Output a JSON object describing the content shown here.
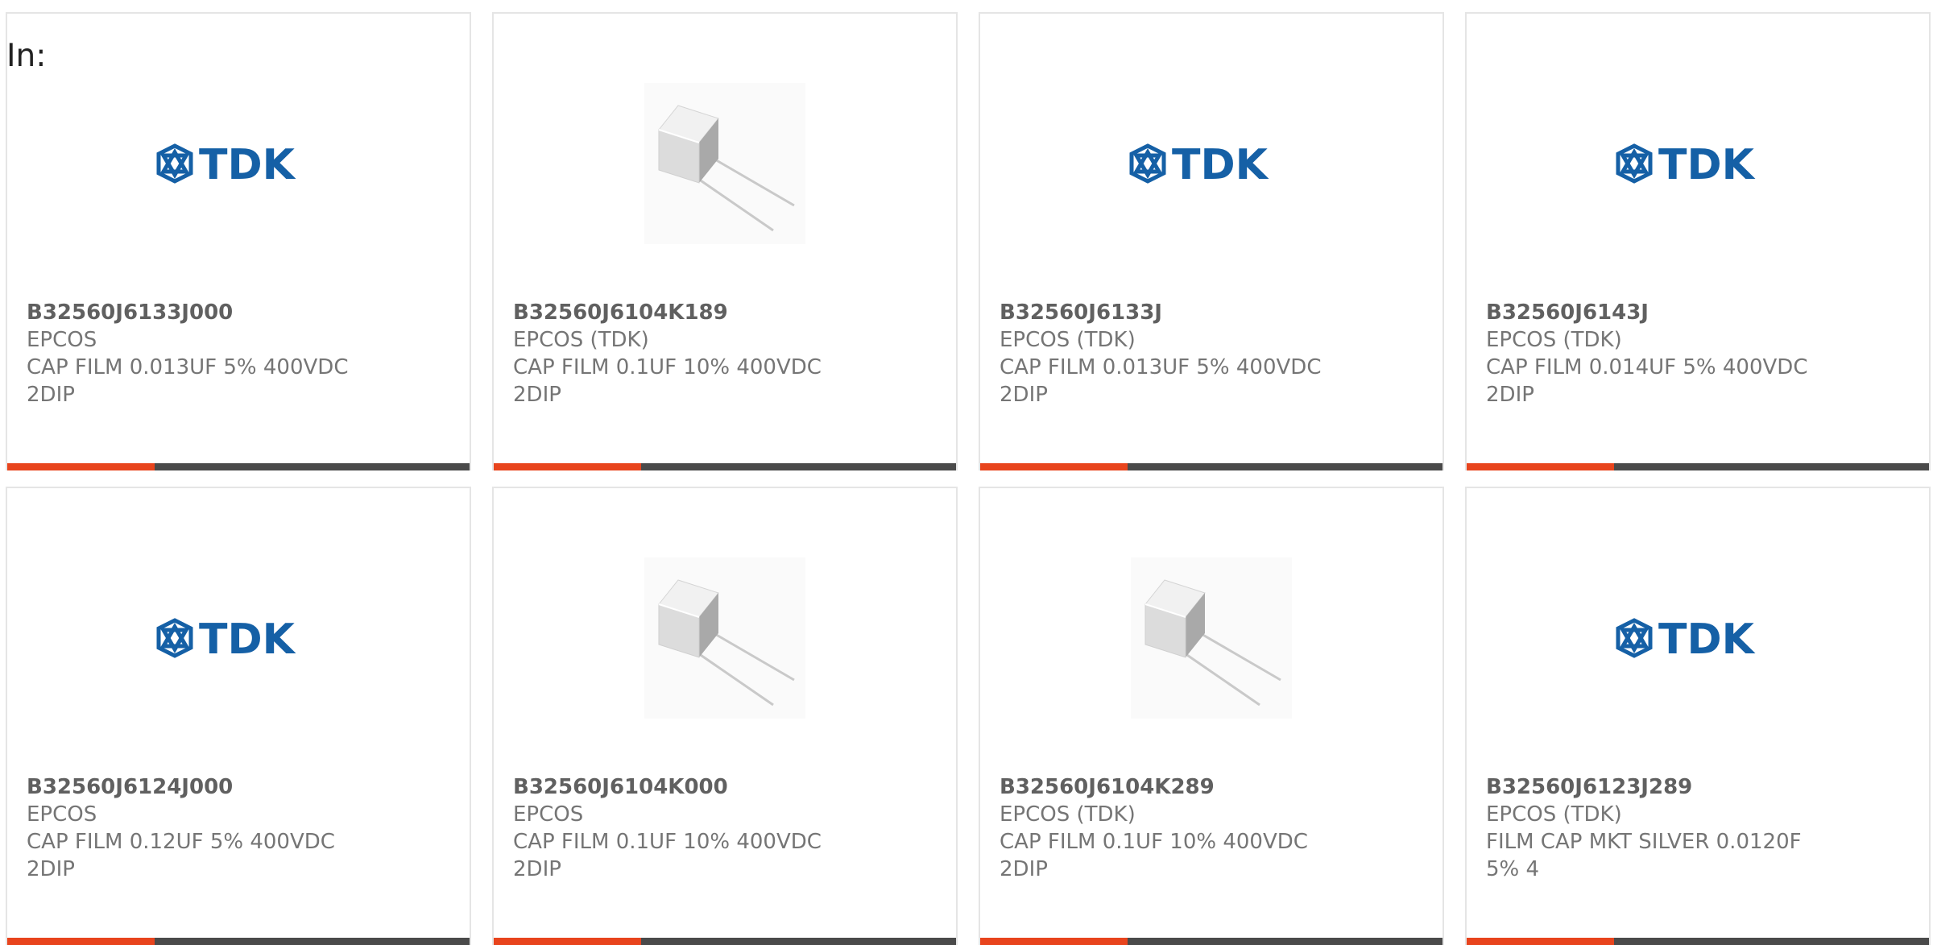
{
  "header": {
    "in_label": "In:"
  },
  "colors": {
    "accent": "#e8441d",
    "bar_dark": "#4a4a4a",
    "tdk_blue": "#1560a6"
  },
  "brand": {
    "logo_text": "TDK"
  },
  "products": [
    {
      "part_number": "B32560J6133J000",
      "manufacturer": "EPCOS",
      "description": "CAP FILM 0.013UF 5% 400VDC",
      "package": "2DIP",
      "image": "tdk-logo"
    },
    {
      "part_number": "B32560J6104K189",
      "manufacturer": "EPCOS (TDK)",
      "description": "CAP FILM 0.1UF 10% 400VDC",
      "package": "2DIP",
      "image": "capacitor-photo"
    },
    {
      "part_number": "B32560J6133J",
      "manufacturer": "EPCOS (TDK)",
      "description": "CAP FILM 0.013UF 5% 400VDC",
      "package": "2DIP",
      "image": "tdk-logo"
    },
    {
      "part_number": "B32560J6143J",
      "manufacturer": "EPCOS (TDK)",
      "description": "CAP FILM 0.014UF 5% 400VDC",
      "package": "2DIP",
      "image": "tdk-logo"
    },
    {
      "part_number": "B32560J6124J000",
      "manufacturer": "EPCOS",
      "description": "CAP FILM 0.12UF 5% 400VDC",
      "package": "2DIP",
      "image": "tdk-logo"
    },
    {
      "part_number": "B32560J6104K000",
      "manufacturer": "EPCOS",
      "description": "CAP FILM 0.1UF 10% 400VDC",
      "package": "2DIP",
      "image": "capacitor-photo"
    },
    {
      "part_number": "B32560J6104K289",
      "manufacturer": "EPCOS (TDK)",
      "description": "CAP FILM 0.1UF 10% 400VDC",
      "package": "2DIP",
      "image": "capacitor-photo"
    },
    {
      "part_number": "B32560J6123J289",
      "manufacturer": "EPCOS (TDK)",
      "description": "FILM CAP MKT SILVER 0.0120F",
      "package": "5% 4",
      "image": "tdk-logo"
    }
  ]
}
